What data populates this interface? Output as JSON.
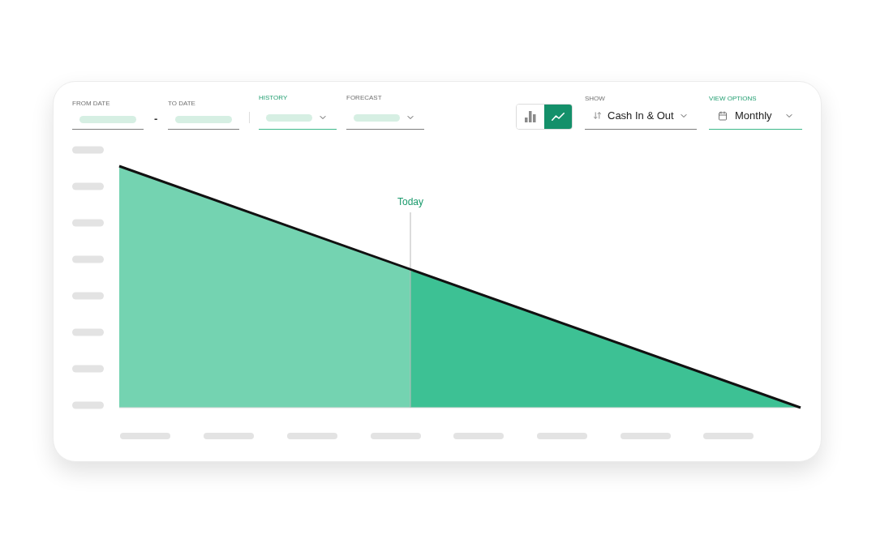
{
  "date_range": {
    "from": {
      "label": "FROM DATE",
      "highlighted": false
    },
    "separator": "-",
    "to": {
      "label": "TO DATE",
      "highlighted": false
    }
  },
  "period_selects": [
    {
      "label": "HISTORY",
      "highlighted": true
    },
    {
      "label": "FORECAST",
      "highlighted": false
    }
  ],
  "chart_type_toggle": [
    {
      "kind": "bar",
      "selected": false
    },
    {
      "kind": "line",
      "selected": true
    }
  ],
  "show": {
    "label": "SHOW",
    "value": "Cash In & Out",
    "highlighted": false
  },
  "view_options": {
    "label": "VIEW OPTIONS",
    "value": "Monthly",
    "highlighted": true
  },
  "chart": {
    "marker_label": "Today"
  }
}
